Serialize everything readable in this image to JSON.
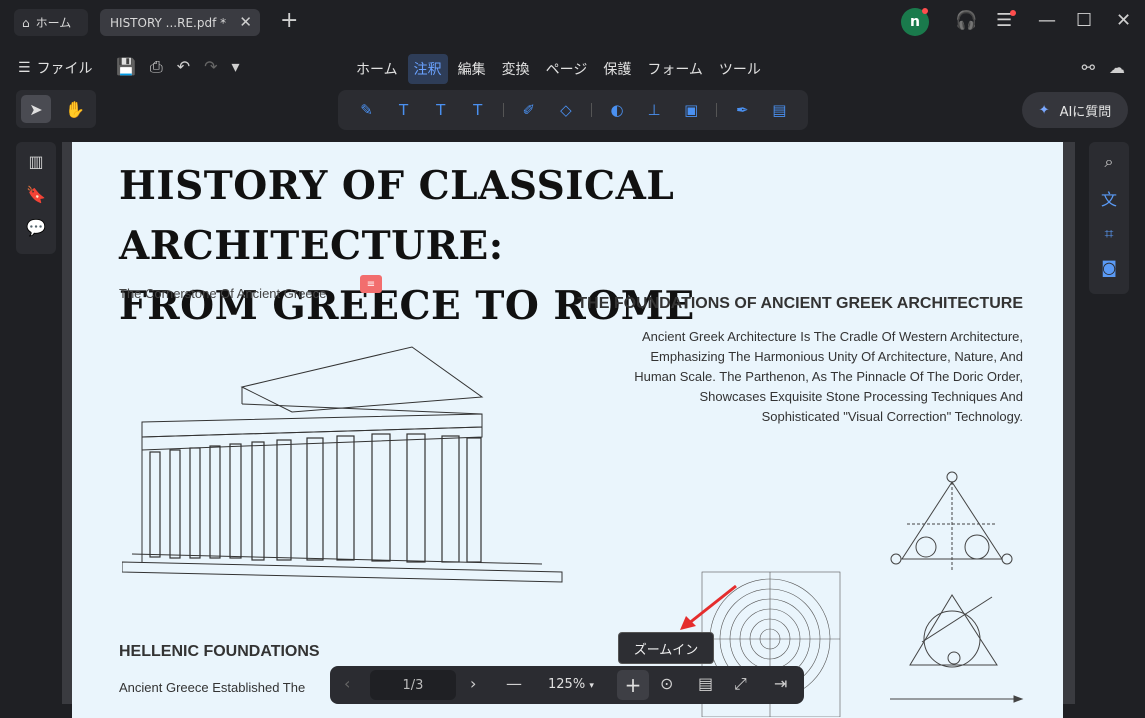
{
  "titlebar": {
    "home_tab": "ホーム",
    "doc_tab": "HISTORY ...RE.pdf *",
    "avatar_letter": "n"
  },
  "menubar": {
    "file_label": "ファイル",
    "tabs": [
      "ホーム",
      "注釈",
      "編集",
      "変換",
      "ページ",
      "保護",
      "フォーム",
      "ツール"
    ],
    "active_tab": "注釈"
  },
  "ai_button": {
    "label": "AIに質問"
  },
  "document": {
    "title_line1": "HISTORY OF CLASSICAL  ARCHITECTURE:",
    "title_line2": "FROM GREECE TO ROME",
    "subtitle": "The Cornerstone Of Ancient Greece",
    "section_title": "THE FOUNDATIONS OF ANCIENT GREEK ARCHITECTURE",
    "section_body": "Ancient Greek Architecture Is The Cradle Of Western Architecture, Emphasizing The Harmonious Unity Of Architecture, Nature, And Human Scale. The Parthenon, As The Pinnacle Of The Doric Order, Showcases Exquisite Stone Processing Techniques And Sophisticated \"Visual Correction\" Technology.",
    "hellenic_title": "HELLENIC FOUNDATIONS",
    "hellenic_body": "Ancient Greece Established The"
  },
  "zoom_bar": {
    "page_indicator": "1/3",
    "zoom_value": "125%",
    "tooltip": "ズームイン"
  },
  "colors": {
    "accent": "#4a90f0",
    "active_tab_bg": "#2e3d58",
    "page_bg": "#eaf5fc"
  }
}
